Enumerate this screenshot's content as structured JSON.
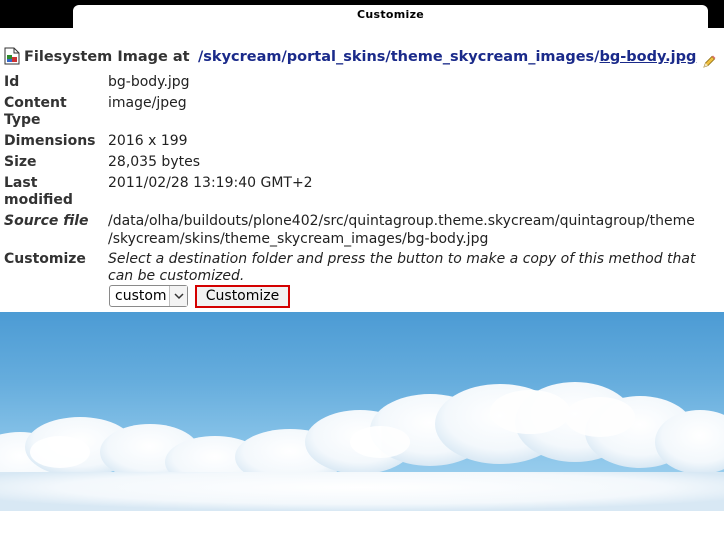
{
  "window": {
    "title": "Customize"
  },
  "header": {
    "label": "Filesystem Image at",
    "breadcrumbs": [
      {
        "text": "/skycream"
      },
      {
        "text": "/portal_skins"
      },
      {
        "text": "/theme_skycream_images"
      },
      {
        "text": "/"
      },
      {
        "text": "bg-body.jpg"
      }
    ]
  },
  "properties": {
    "id_label": "Id",
    "id_value": "bg-body.jpg",
    "content_type_label_1": "Content",
    "content_type_label_2": "Type",
    "content_type_value": "image/jpeg",
    "dimensions_label": "Dimensions",
    "dimensions_value": "2016 x 199",
    "size_label": "Size",
    "size_value": "28,035 bytes",
    "last_modified_label_1": "Last",
    "last_modified_label_2": "modified",
    "last_modified_value": "2011/02/28 13:19:40 GMT+2",
    "source_file_label": "Source file",
    "source_file_line1": "/data/olha/buildouts/plone402/src/quintagroup.theme.skycream/quintagroup/theme",
    "source_file_line2": "/skycream/skins/theme_skycream_images/bg-body.jpg"
  },
  "customize": {
    "label": "Customize",
    "description": "Select a destination folder and press the button to make a copy of this method that can be customized.",
    "folder_selected": "custom",
    "button_label": "Customize"
  },
  "colors": {
    "link": "#1a2a8a",
    "button_border": "#d40000",
    "sky_top": "#4c9bd4"
  }
}
